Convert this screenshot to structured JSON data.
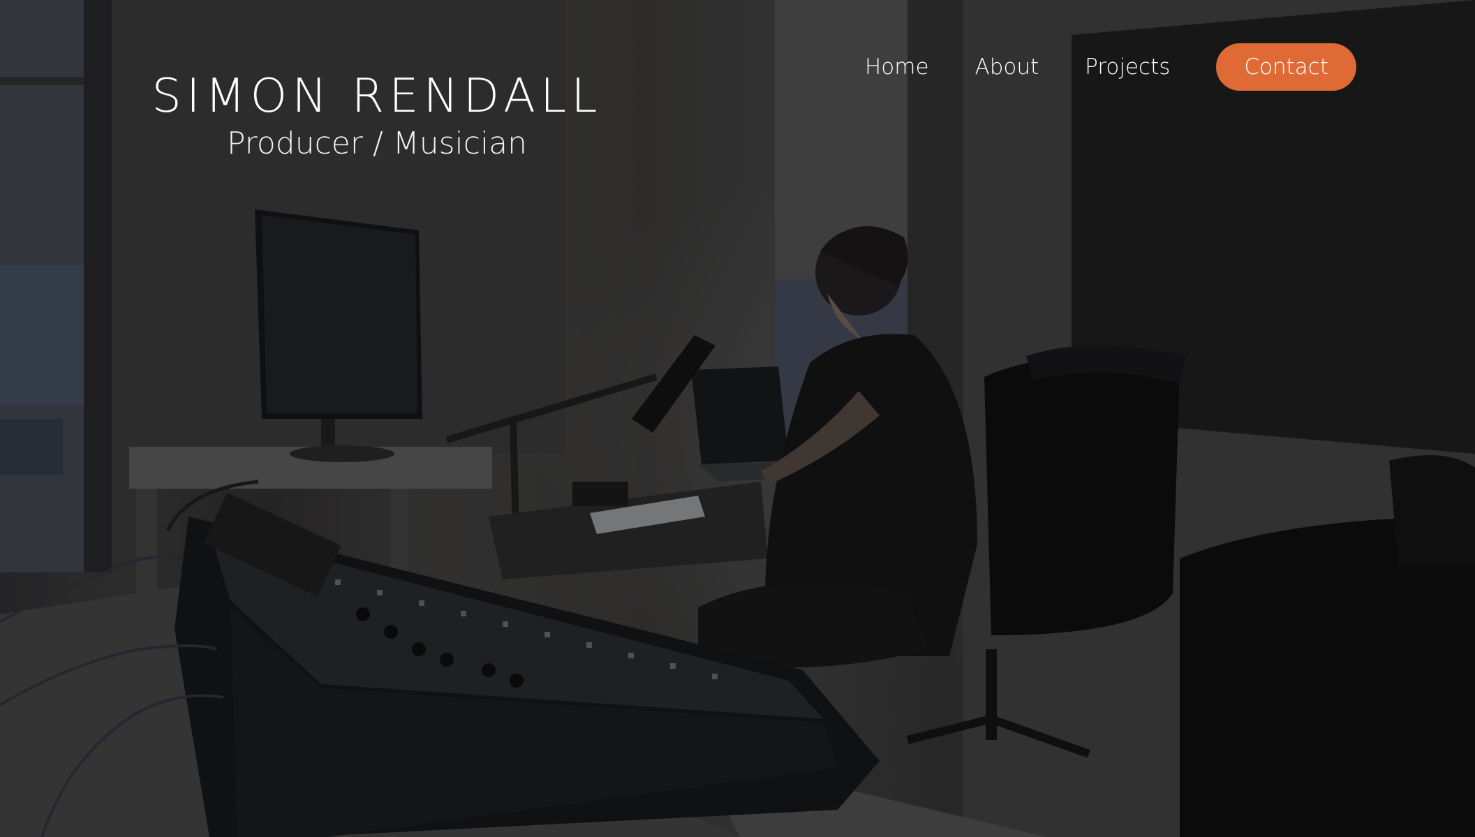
{
  "header": {
    "name": "SIMON RENDALL",
    "tagline": "Producer / Musician"
  },
  "nav": {
    "items": [
      {
        "label": "Home"
      },
      {
        "label": "About"
      },
      {
        "label": "Projects"
      }
    ],
    "cta_label": "Contact"
  },
  "colors": {
    "accent": "#e06a36",
    "text": "#ffffff"
  },
  "hero_image": {
    "icon": "studio-photo"
  }
}
